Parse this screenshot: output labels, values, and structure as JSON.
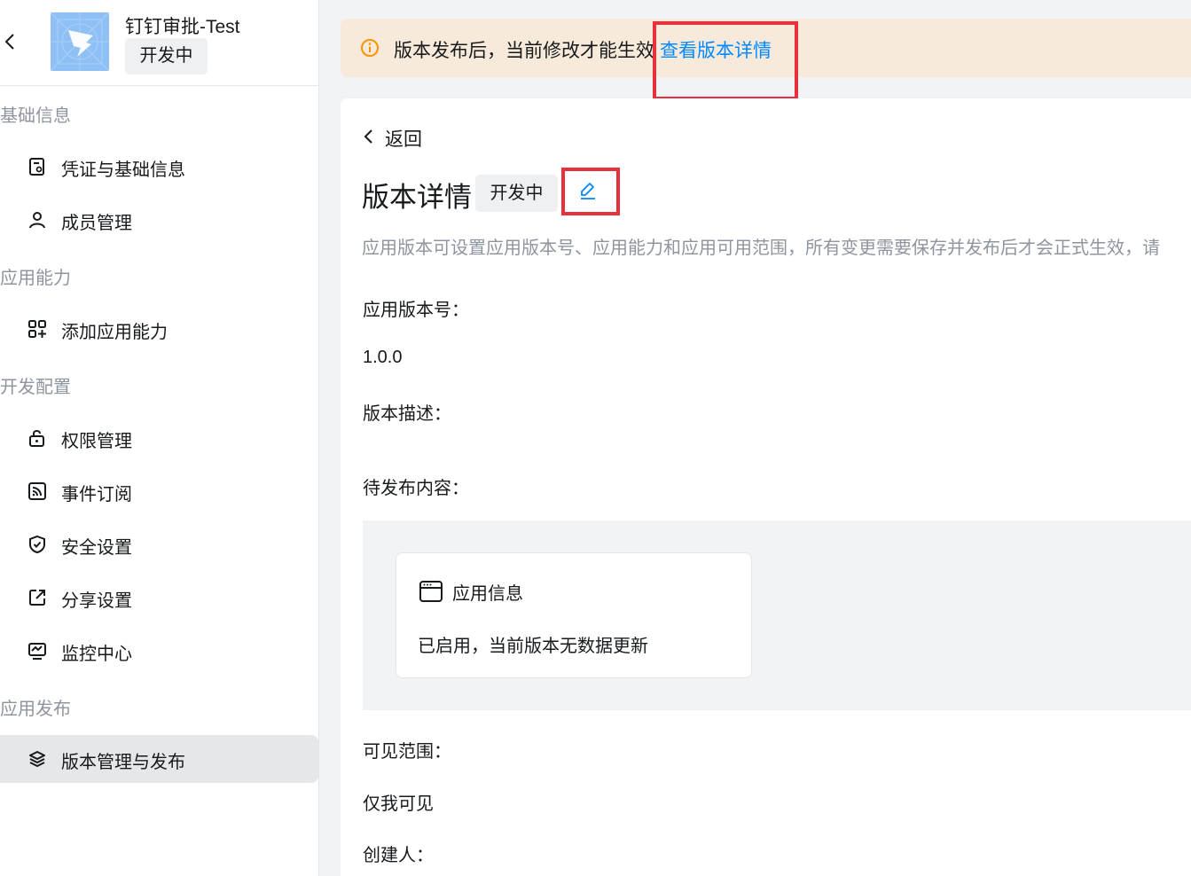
{
  "app": {
    "name": "钉钉审批-Test",
    "status": "开发中",
    "logo_icon": "dingtalk-logo"
  },
  "sidebar": {
    "sections": [
      {
        "title": "基础信息",
        "items": [
          {
            "label": "凭证与基础信息",
            "icon": "credential-icon"
          },
          {
            "label": "成员管理",
            "icon": "user-icon"
          }
        ]
      },
      {
        "title": "应用能力",
        "items": [
          {
            "label": "添加应用能力",
            "icon": "grid-plus-icon"
          }
        ]
      },
      {
        "title": "开发配置",
        "items": [
          {
            "label": "权限管理",
            "icon": "unlock-icon"
          },
          {
            "label": "事件订阅",
            "icon": "rss-icon"
          },
          {
            "label": "安全设置",
            "icon": "shield-icon"
          },
          {
            "label": "分享设置",
            "icon": "share-icon"
          },
          {
            "label": "监控中心",
            "icon": "monitor-icon"
          }
        ]
      },
      {
        "title": "应用发布",
        "items": [
          {
            "label": "版本管理与发布",
            "icon": "layers-icon",
            "active": true
          }
        ]
      }
    ]
  },
  "notice": {
    "text": "版本发布后，当前修改才能生效",
    "link": "查看版本详情",
    "icon": "info-icon"
  },
  "detail": {
    "back": "返回",
    "title": "版本详情",
    "status": "开发中",
    "description": "应用版本可设置应用版本号、应用能力和应用可用范围，所有变更需要保存并发布后才会正式生效，请",
    "version_label": "应用版本号：",
    "version_value": "1.0.0",
    "version_desc_label": "版本描述：",
    "pending_label": "待发布内容：",
    "pending_card": {
      "title": "应用信息",
      "text": "已启用，当前版本无数据更新",
      "icon": "window-icon"
    },
    "scope_label": "可见范围：",
    "scope_value": "仅我可见",
    "creator_label": "创建人："
  },
  "colors": {
    "accent": "#0089ff",
    "notice_bg": "#f7eadb",
    "notice_icon": "#ff9200",
    "highlight": "#e8303a",
    "muted_text": "#8f959e"
  }
}
